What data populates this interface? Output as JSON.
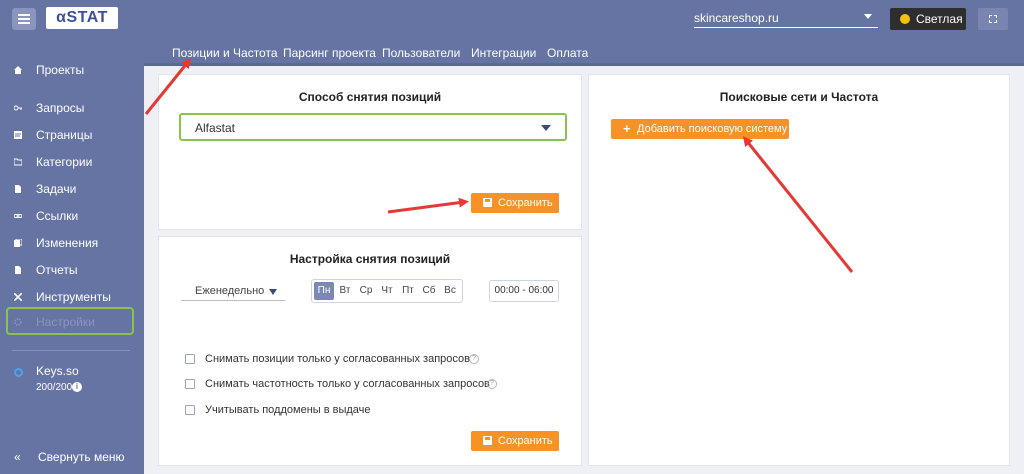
{
  "app": {
    "logo_text": "αSTAT",
    "domain": "skincareshop.ru",
    "theme_label": "Светлая"
  },
  "sidebar": {
    "items": [
      {
        "label": "Проекты",
        "icon": "home-icon"
      },
      {
        "label": "Запросы",
        "icon": "key-icon"
      },
      {
        "label": "Страницы",
        "icon": "page-icon"
      },
      {
        "label": "Категории",
        "icon": "folder-icon"
      },
      {
        "label": "Задачи",
        "icon": "task-icon"
      },
      {
        "label": "Ссылки",
        "icon": "link-icon"
      },
      {
        "label": "Изменения",
        "icon": "changes-icon"
      },
      {
        "label": "Отчеты",
        "icon": "report-icon"
      },
      {
        "label": "Инструменты",
        "icon": "tools-icon"
      },
      {
        "label": "Настройки",
        "icon": "gear-icon"
      }
    ],
    "keys_label": "Keys.so",
    "keys_count": "200/200",
    "collapse_label": "Свернуть меню",
    "collapse_icon": "«"
  },
  "tabs": [
    {
      "label": "Позиции и Частота"
    },
    {
      "label": "Парсинг проекта"
    },
    {
      "label": "Пользователи"
    },
    {
      "label": "Интеграции"
    },
    {
      "label": "Оплата"
    }
  ],
  "method_panel": {
    "title": "Способ снятия позиций",
    "selected": "Alfastat",
    "save_label": "Сохранить"
  },
  "schedule_panel": {
    "title": "Настройка снятия позиций",
    "frequency": "Еженедельно",
    "days": [
      "Пн",
      "Вт",
      "Ср",
      "Чт",
      "Пт",
      "Сб",
      "Вс"
    ],
    "selected_day": "Пн",
    "time_range": "00:00 - 06:00",
    "checkboxes": [
      {
        "label": "Снимать позиции только у согласованных запросов",
        "checked": false
      },
      {
        "label": "Снимать частотность только у согласованных запросов",
        "checked": false
      },
      {
        "label": "Учитывать поддомены в выдаче",
        "checked": false
      }
    ],
    "save_label": "Сохранить"
  },
  "engines_panel": {
    "title": "Поисковые сети и Частота",
    "add_label": "Добавить поисковую систему"
  },
  "colors": {
    "header": "#6674a4",
    "accent_orange": "#f79226",
    "highlight_green": "#8bc34a",
    "annotation_red": "#e53935"
  }
}
